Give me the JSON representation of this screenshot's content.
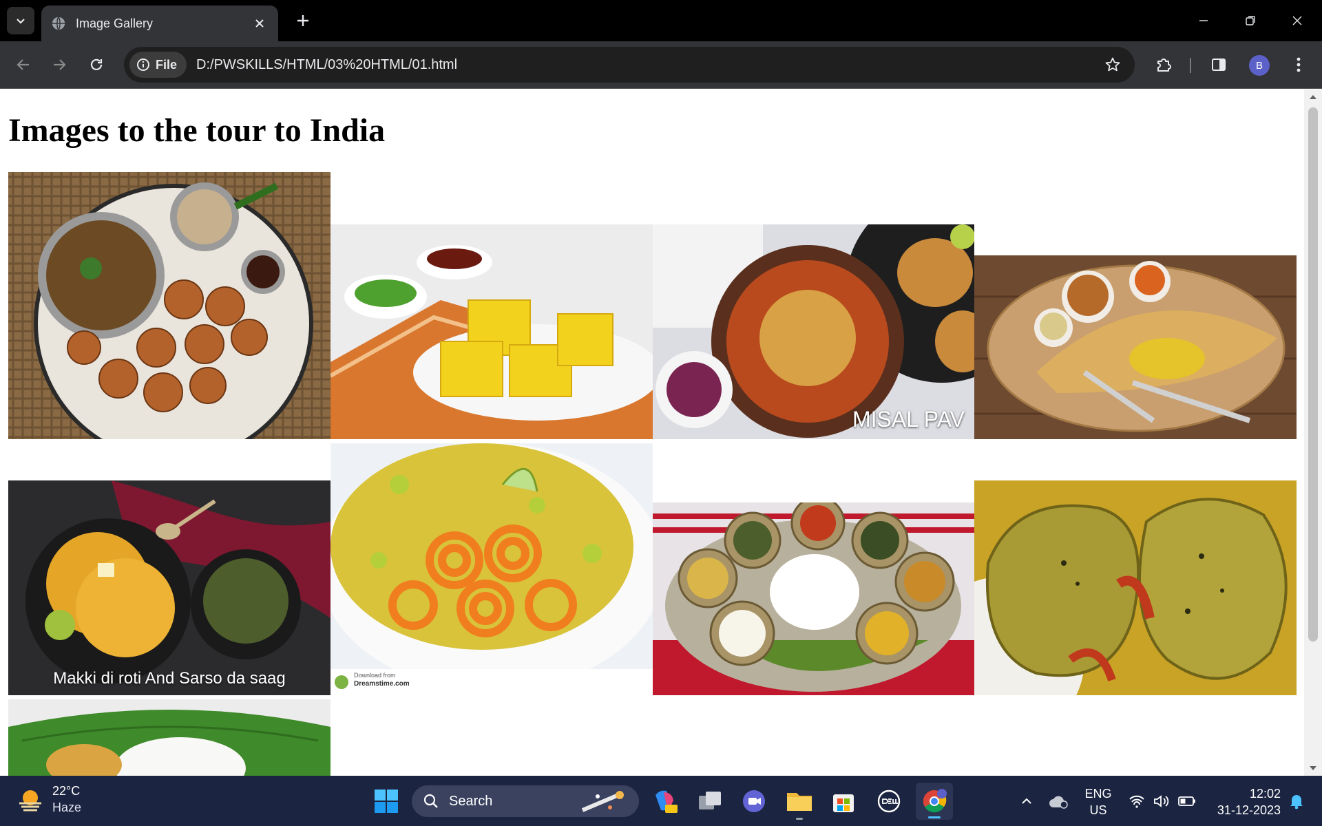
{
  "browser": {
    "tab_title": "Image Gallery",
    "chip_label": "File",
    "url": "D:/PWSKILLS/HTML/03%20HTML/01.html",
    "profile_initial": "B"
  },
  "page": {
    "heading": "Images to the tour to India",
    "images": [
      {
        "name": "Dal baati churma"
      },
      {
        "name": "Dhokla"
      },
      {
        "name": "Misal pav",
        "caption": "MISAL PAV"
      },
      {
        "name": "Masala dosa"
      },
      {
        "name": "Makki di roti and sarso da saag",
        "caption": "Makki di roti And Sarso da saag"
      },
      {
        "name": "Poha jalebi",
        "watermark_1": "Download from",
        "watermark_2": "Dreamstime.com"
      },
      {
        "name": "Assamese thali"
      },
      {
        "name": "Bengali fish curry"
      },
      {
        "name": "Banana leaf meal"
      }
    ]
  },
  "taskbar": {
    "temperature": "22°C",
    "condition": "Haze",
    "search_label": "Search",
    "language_1": "ENG",
    "language_2": "US",
    "time": "12:02",
    "date": "31-12-2023"
  },
  "colors": {
    "titlebar": "#000000",
    "toolbar": "#333437",
    "taskbar": "#1b2440",
    "avatar": "#5c61c9"
  }
}
